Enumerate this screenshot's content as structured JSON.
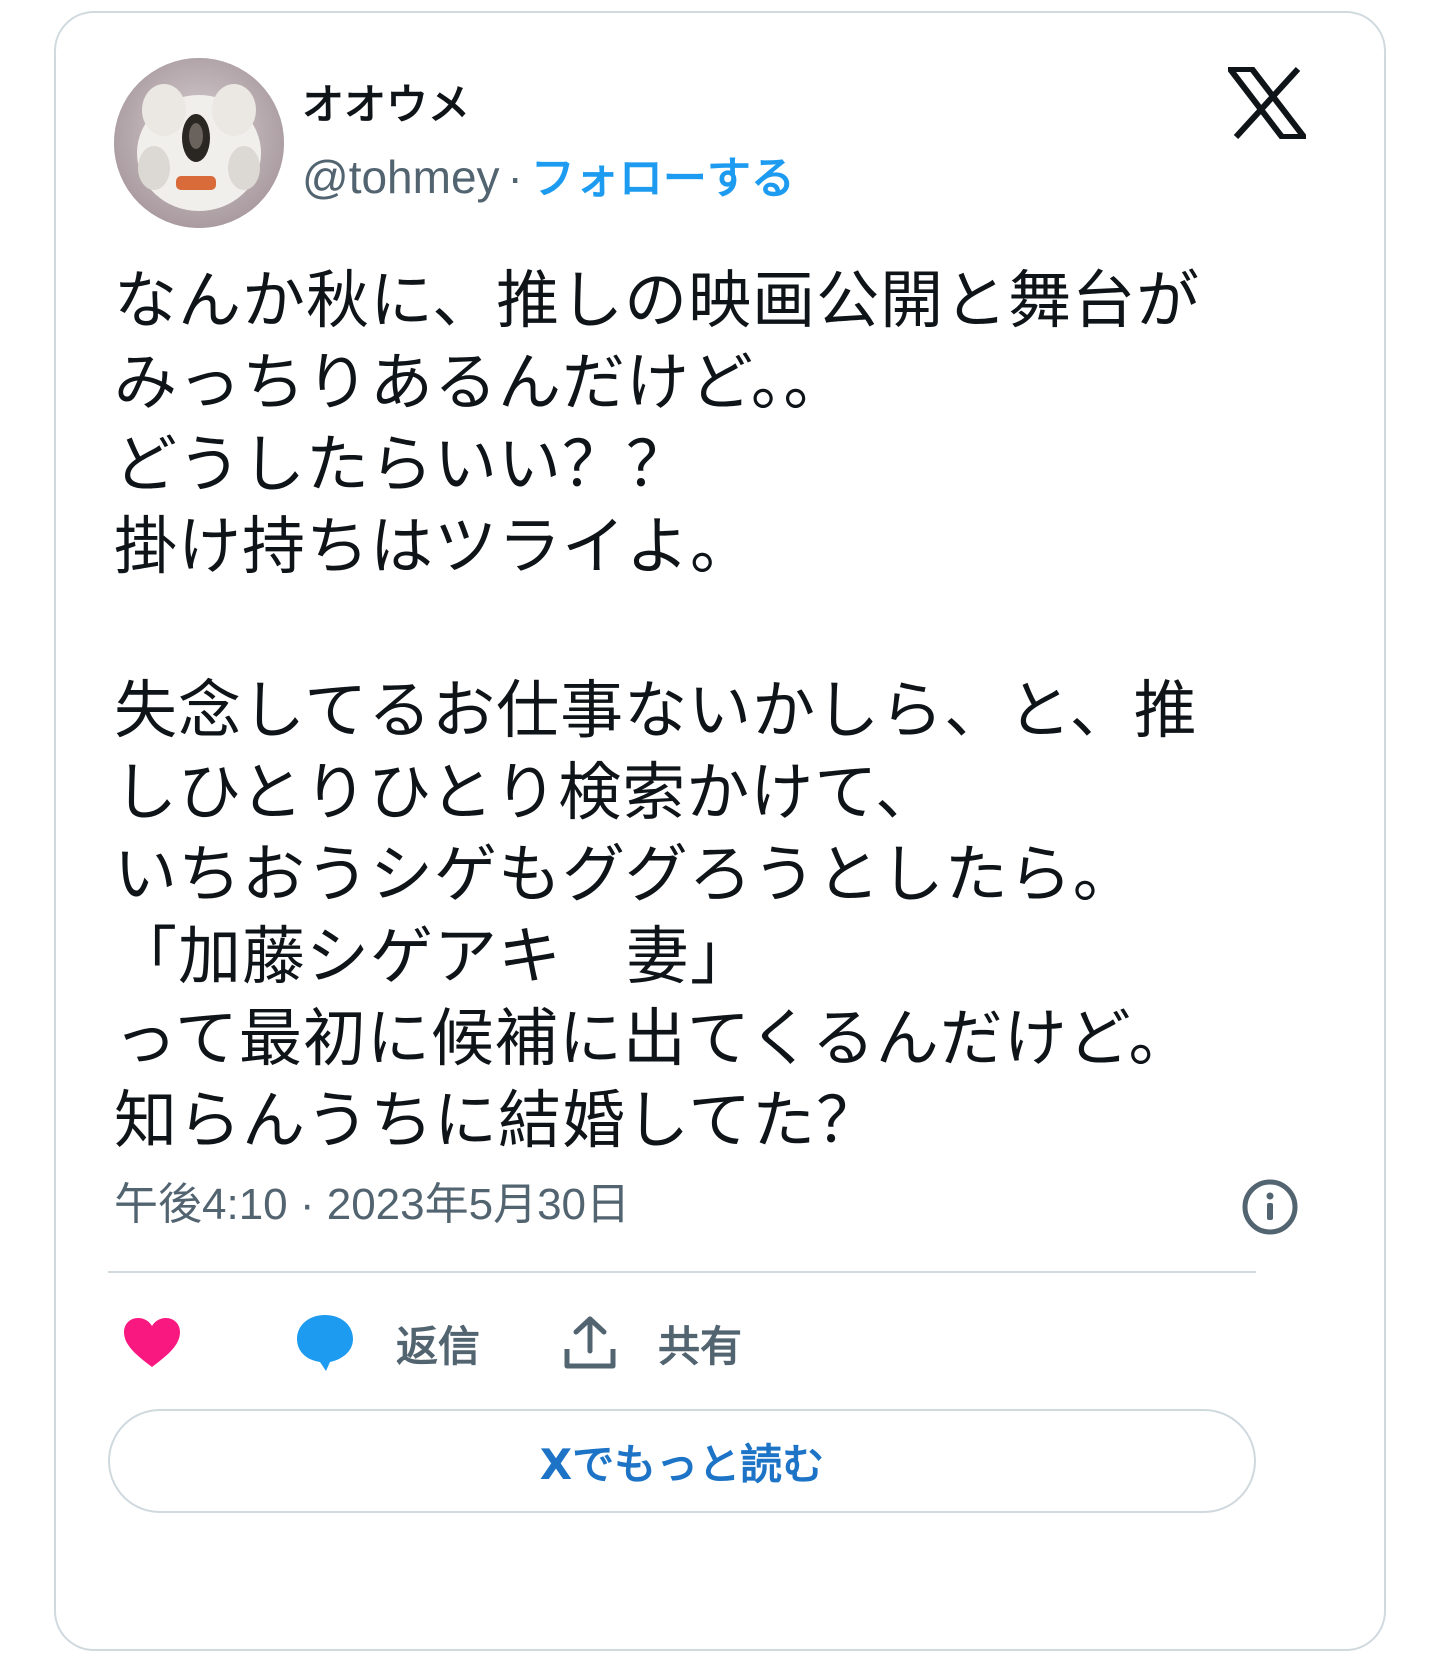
{
  "author": {
    "name": "オオウメ",
    "handle": "@tohmey",
    "separator": "·",
    "follow_label": "フォローする"
  },
  "tweet": {
    "text": "なんか秋に、推しの映画公開と舞台が\nみっちりあるんだけど。。\nどうしたらいい？？\n掛け持ちはツライよ。\n\n失念してるお仕事ないかしら、と、推\nしひとりひとり検索かけて、\nいちおうシゲもググろうとしたら。\n「加藤シゲアキ　妻」\nって最初に候補に出てくるんだけど。\n知らんうちに結婚してた？"
  },
  "timestamp": "午後4:10 · 2023年5月30日",
  "actions": {
    "like_label": "",
    "reply_label": "返信",
    "share_label": "共有"
  },
  "read_more_label": "Xでもっと読む",
  "colors": {
    "accent": "#1d9bf0",
    "like": "#f91880",
    "muted": "#536471",
    "border": "#cfd9de"
  },
  "icons": {
    "brand": "x-logo-icon",
    "info": "info-icon",
    "like": "heart-icon",
    "reply": "speech-bubble-icon",
    "share": "share-upload-icon"
  }
}
